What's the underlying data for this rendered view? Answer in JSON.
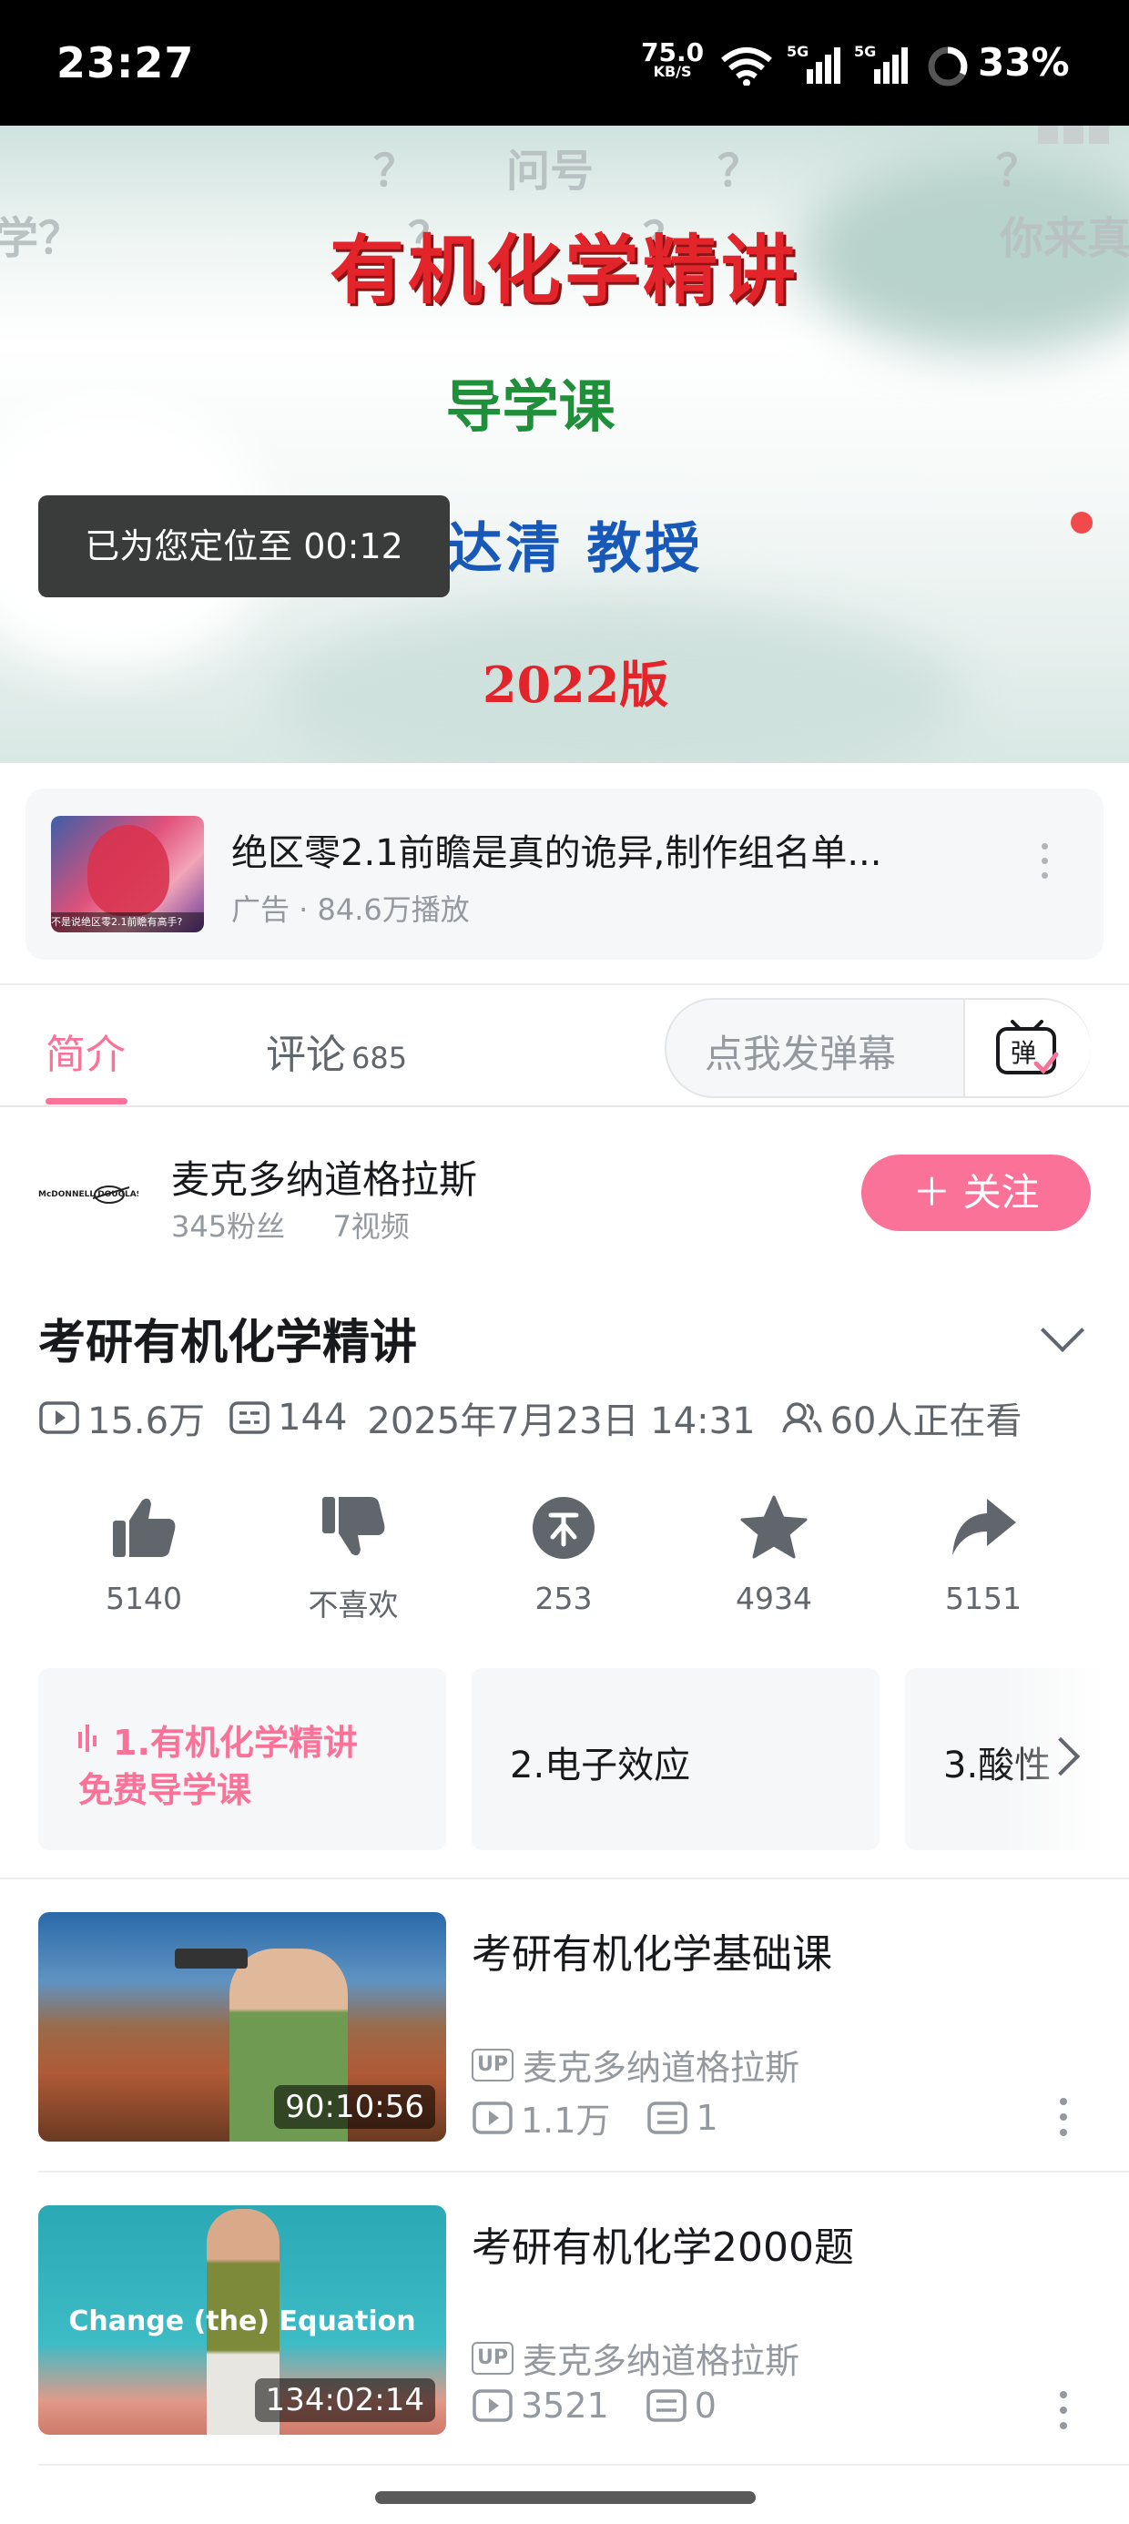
{
  "status_bar": {
    "time": "23:27",
    "net_speed": "75.0",
    "net_unit": "KB/S",
    "battery": "33%"
  },
  "player": {
    "title": "有机化学精讲",
    "subtitle": "导学课",
    "lecturer": "史达清 教授",
    "edition": "2022版",
    "resume_toast": "已为您定位至 00:12",
    "danmaku": [
      "？",
      "问号",
      "？",
      "？",
      "学？",
      "？",
      "？",
      "你来真"
    ]
  },
  "ad": {
    "title": "绝区零2.1前瞻是真的诡异,制作组名单...",
    "subtitle": "广告 · 84.6万播放",
    "thumb_caption": "不是说绝区零2.1前瞻有高手?"
  },
  "tabs": {
    "intro": "简介",
    "comments": "评论",
    "comments_count": "685",
    "danmu_placeholder": "点我发弹幕",
    "danmu_icon_label": "弹"
  },
  "uploader": {
    "logo_text": "McDONNELL DOUGLAS",
    "name": "麦克多纳道格拉斯",
    "fans": "345粉丝",
    "videos": "7视频",
    "follow_label": "＋ 关注"
  },
  "video": {
    "title": "考研有机化学精讲",
    "views": "15.6万",
    "danmaku_count": "144",
    "date": "2025年7月23日 14:31",
    "watching": "60人正在看"
  },
  "actions": {
    "like": "5140",
    "dislike": "不喜欢",
    "coin": "253",
    "favorite": "4934",
    "share": "5151"
  },
  "playlist": [
    {
      "label_line1": "1.有机化学精讲",
      "label_line2": "免费导学课"
    },
    {
      "label": "2.电子效应"
    },
    {
      "label": "3.酸性"
    }
  ],
  "related": [
    {
      "title": "考研有机化学基础课",
      "duration": "90:10:56",
      "up_tag": "UP",
      "uploader": "麦克多纳道格拉斯",
      "views": "1.1万",
      "danmaku": "1"
    },
    {
      "title": "考研有机化学2000题",
      "duration": "134:02:14",
      "thumb_text": "Change (the) Equation",
      "up_tag": "UP",
      "uploader": "麦克多纳道格拉斯",
      "views": "3521",
      "danmaku": "0"
    }
  ],
  "colors": {
    "accent": "#fb7299",
    "text_primary": "#18191c",
    "text_secondary": "#61666d",
    "text_muted": "#9499a0"
  }
}
